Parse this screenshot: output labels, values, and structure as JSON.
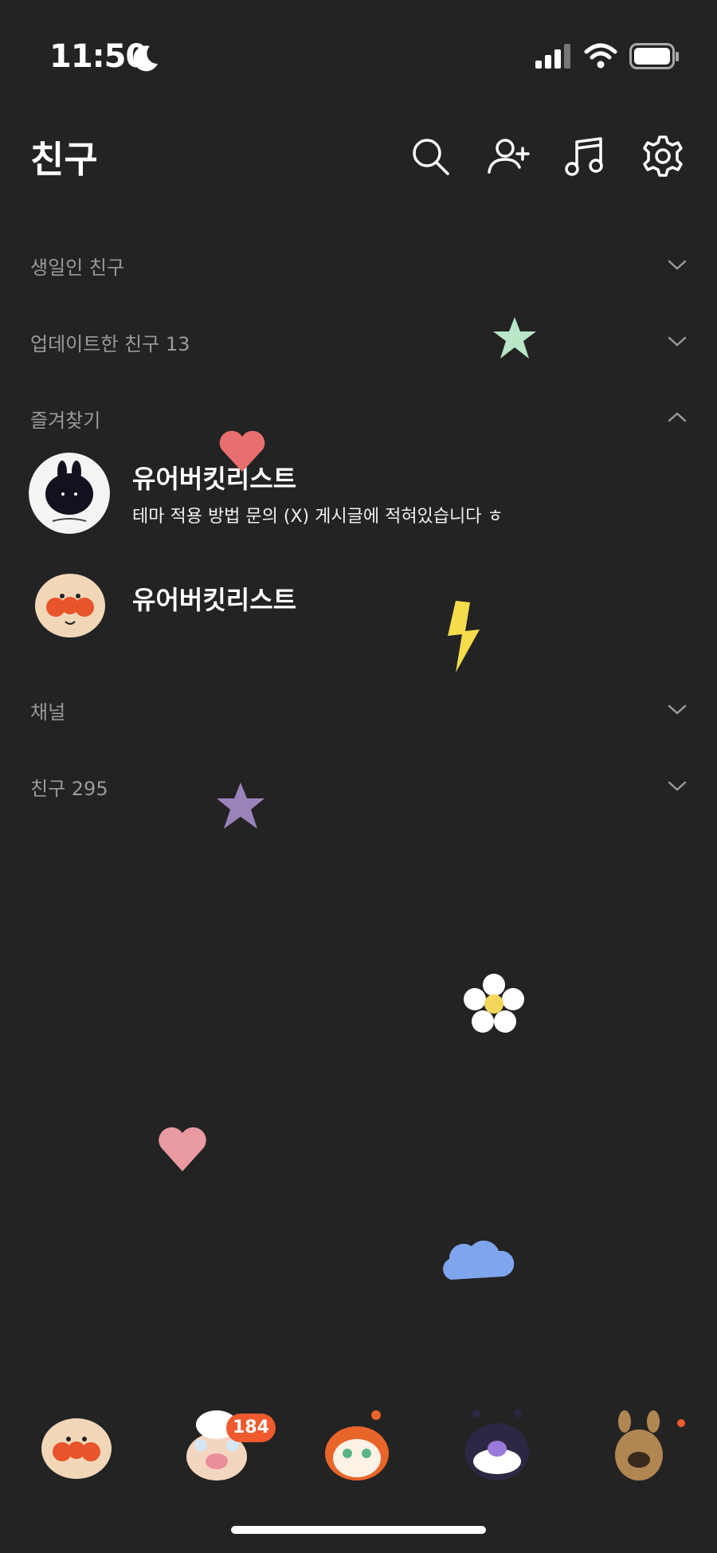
{
  "status_bar": {
    "time": "11:50"
  },
  "header": {
    "title": "친구"
  },
  "sections": {
    "birthday": {
      "label": "생일인 친구"
    },
    "updated": {
      "label": "업데이트한 친구 13"
    },
    "favorites": {
      "label": "즐겨찾기"
    },
    "channel": {
      "label": "채널"
    },
    "friends": {
      "label": "친구 295"
    }
  },
  "favorites": [
    {
      "name": "유어버킷리스트",
      "status": "테마 적용 방법 문의 (X) 게시글에 적혀있습니다 ㅎ"
    },
    {
      "name": "유어버킷리스트"
    }
  ],
  "tab_bar": {
    "chats_badge": "184"
  },
  "colors": {
    "background": "#232323",
    "badge": "#ef5a2f",
    "section_label": "#9a9a9a"
  }
}
